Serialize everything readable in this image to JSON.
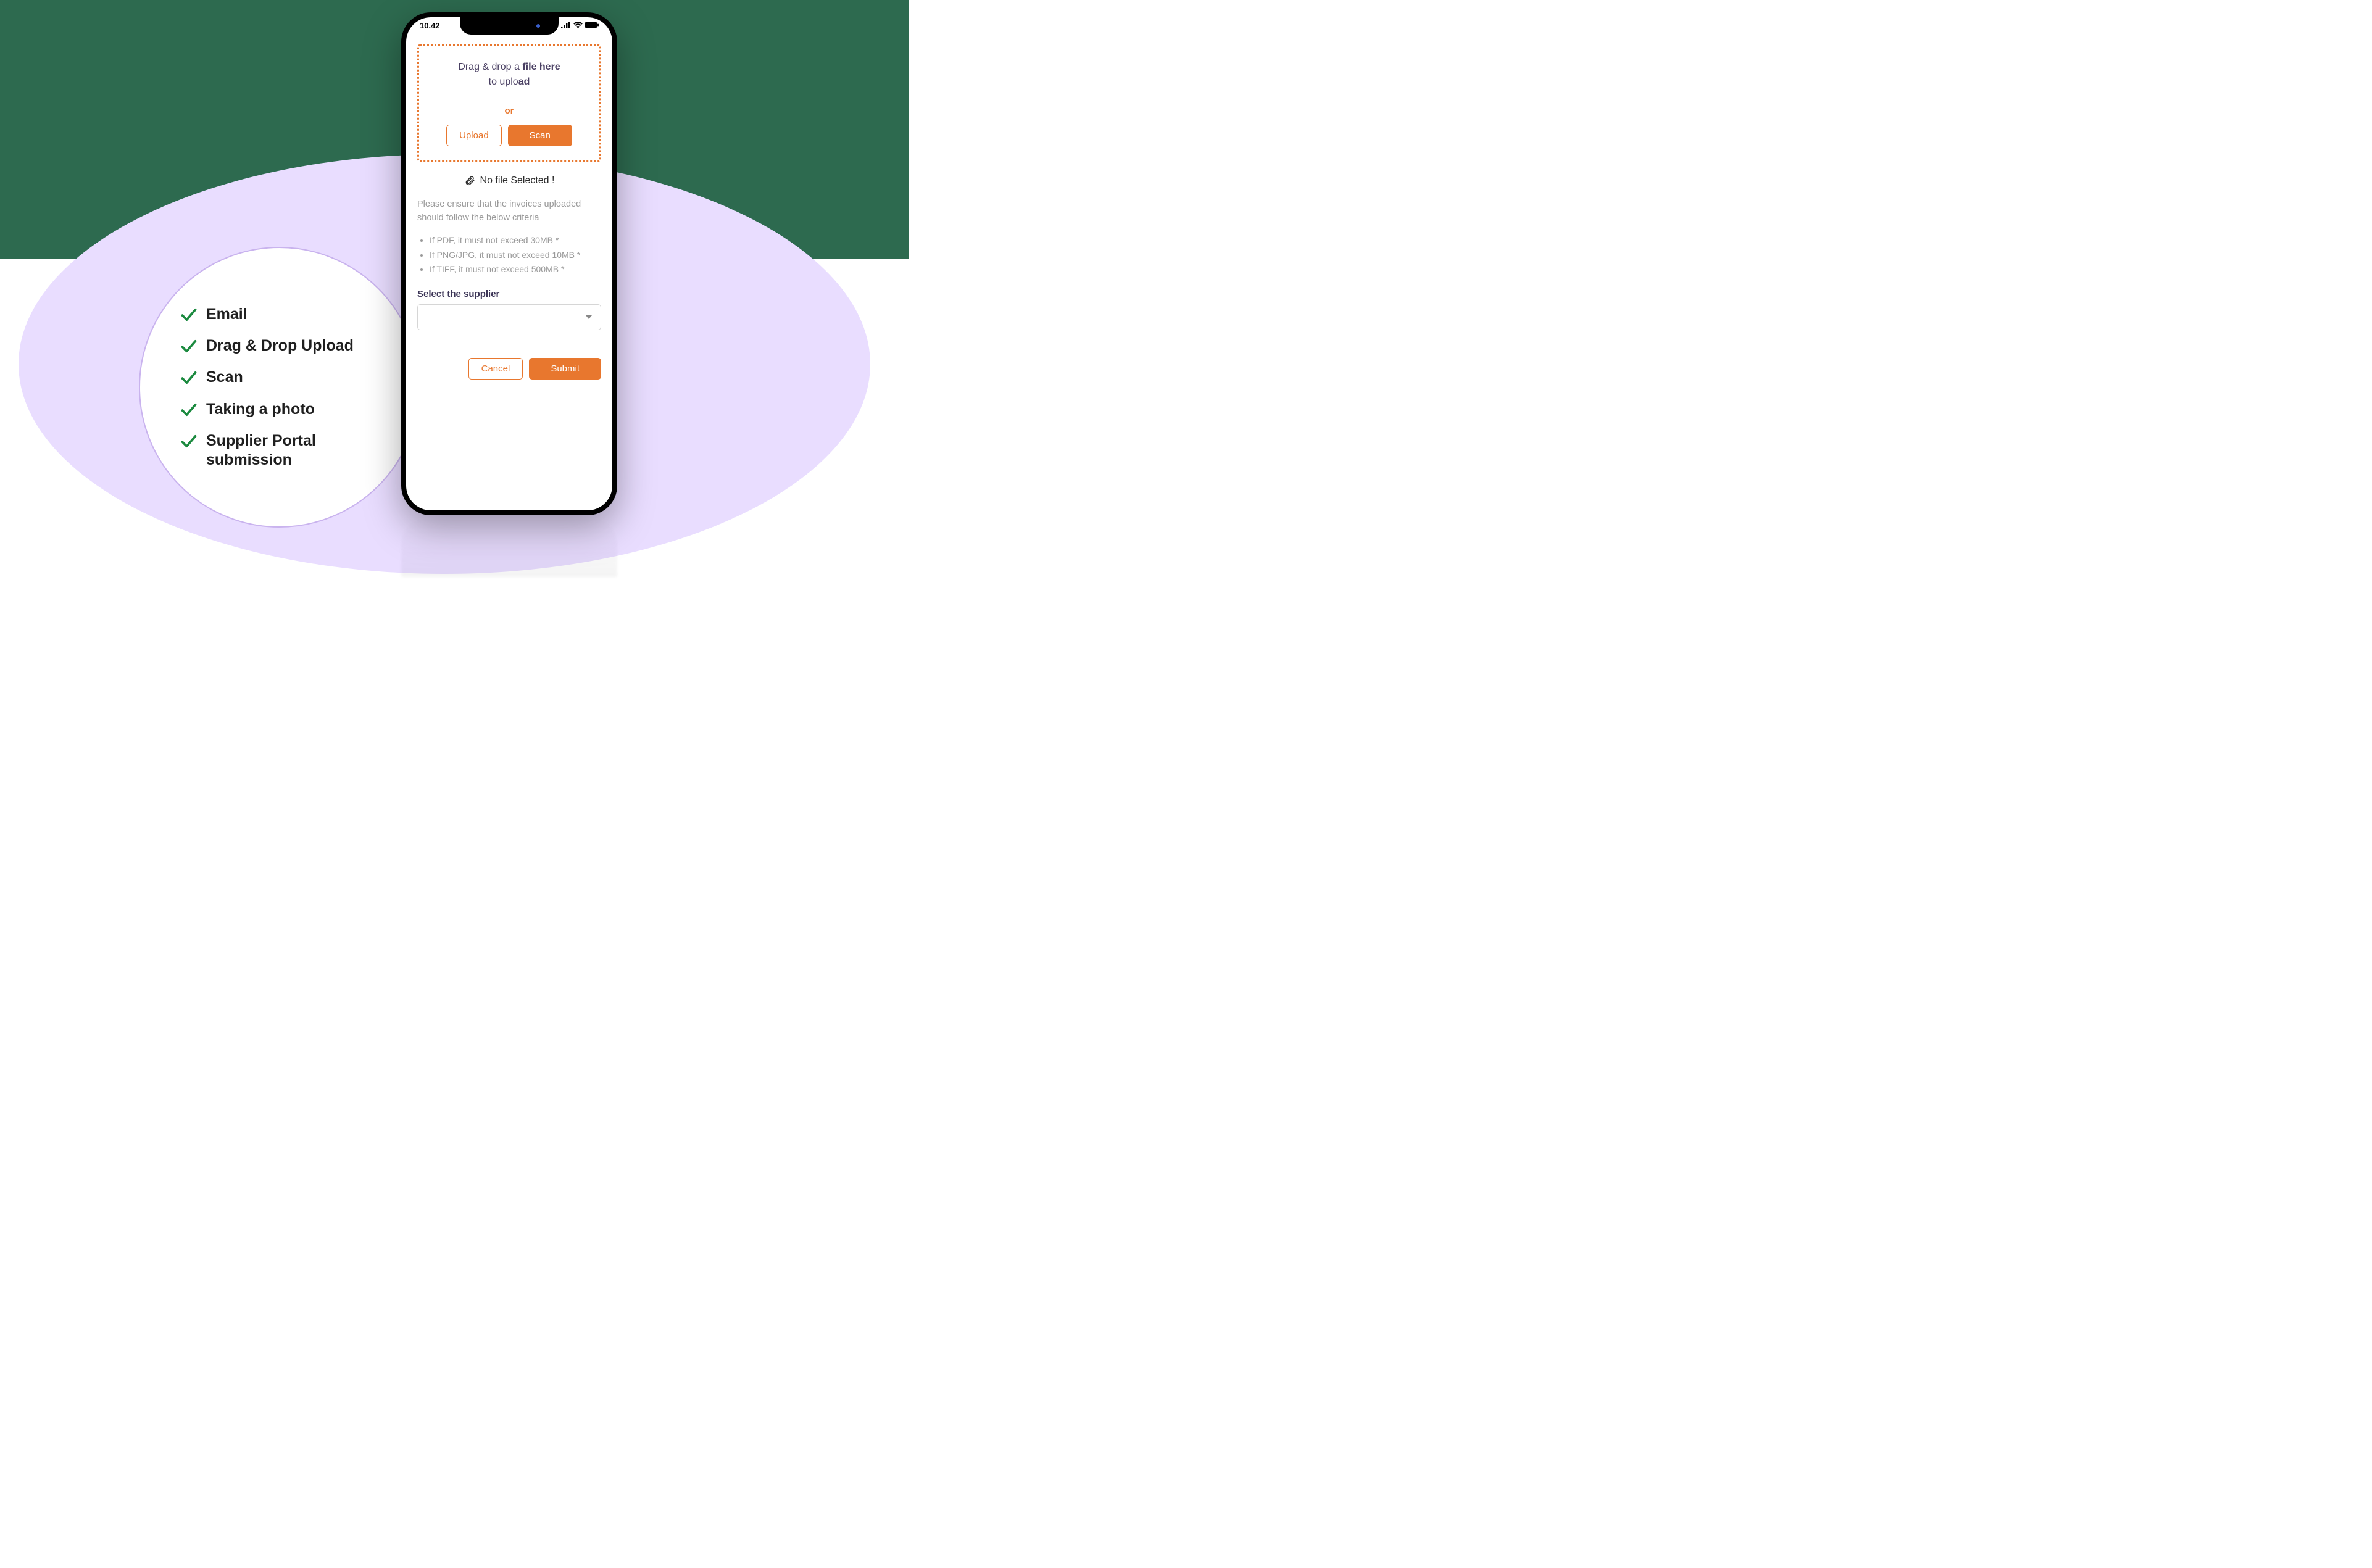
{
  "features": {
    "items": [
      {
        "label": "Email"
      },
      {
        "label": "Drag & Drop Upload"
      },
      {
        "label": "Scan"
      },
      {
        "label": "Taking a photo"
      },
      {
        "label": "Supplier Portal submission"
      }
    ]
  },
  "phone": {
    "status_time": "10.42",
    "dropzone": {
      "line1_prefix": "Drag & drop a ",
      "line1_bold": "file here",
      "line2_prefix": "to uplo",
      "line2_bold": "ad",
      "or_label": "or",
      "upload_label": "Upload",
      "scan_label": "Scan"
    },
    "nofile_label": "No file Selected !",
    "note_text": "Please ensure that the invoices uploaded should follow the below criteria",
    "criteria": {
      "items": [
        "If PDF, it must not exceed 30MB *",
        "If PNG/JPG, it must not exceed 10MB *",
        "If TIFF, it must not exceed 500MB *"
      ]
    },
    "supplier_label": "Select the supplier",
    "cancel_label": "Cancel",
    "submit_label": "Submit"
  }
}
